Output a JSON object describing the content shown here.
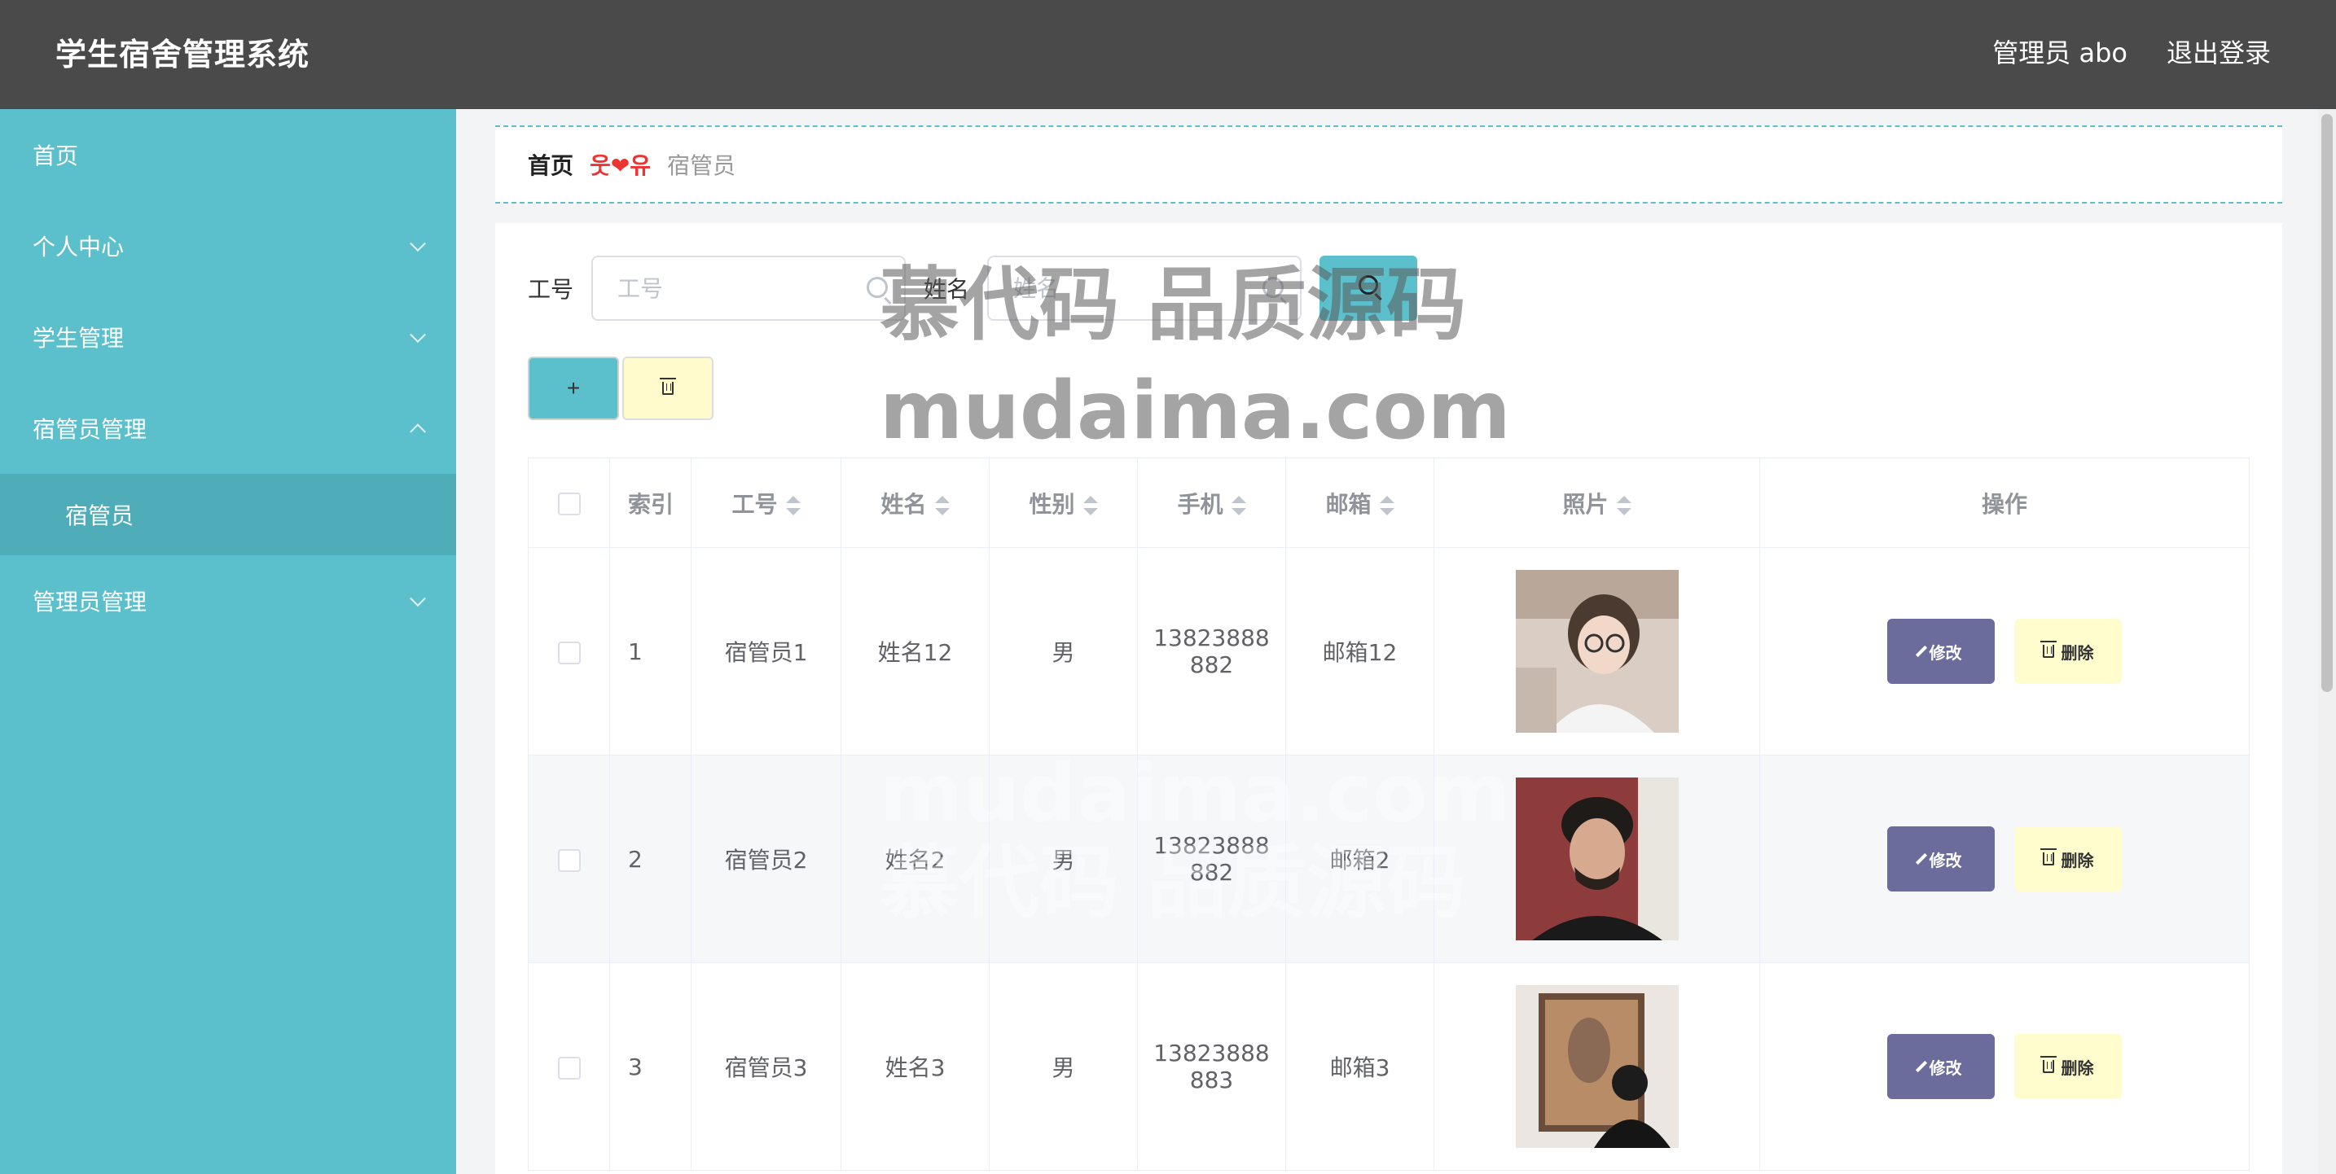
{
  "header": {
    "app_title": "学生宿舍管理系统",
    "admin_label": "管理员 abo",
    "logout_label": "退出登录"
  },
  "sidebar": {
    "items": [
      {
        "label": "首页",
        "expandable": false
      },
      {
        "label": "个人中心",
        "expandable": true
      },
      {
        "label": "学生管理",
        "expandable": true
      },
      {
        "label": "宿管员管理",
        "expandable": true,
        "expanded": true,
        "children": [
          {
            "label": "宿管员"
          }
        ]
      },
      {
        "label": "管理员管理",
        "expandable": true
      }
    ]
  },
  "breadcrumb": {
    "home": "首页",
    "separator": "웃❤유",
    "current": "宿管员"
  },
  "search": {
    "field1_label": "工号",
    "field1_placeholder": "工号",
    "field2_label": "姓名",
    "field2_placeholder": "姓名"
  },
  "actions": {
    "add_label": "+"
  },
  "table": {
    "headers": [
      "索引",
      "工号",
      "姓名",
      "性别",
      "手机",
      "邮箱",
      "照片",
      "操作"
    ],
    "edit_label": "修改",
    "delete_label": "删除",
    "rows": [
      {
        "index": "1",
        "job_no": "宿管员1",
        "name": "姓名12",
        "gender": "男",
        "phone_line1": "13823888",
        "phone_line2": "882",
        "email": "邮箱12",
        "photo": "avatar-girl-glasses"
      },
      {
        "index": "2",
        "job_no": "宿管员2",
        "name": "姓名2",
        "gender": "男",
        "phone_line1": "13823888",
        "phone_line2": "882",
        "email": "邮箱2",
        "photo": "avatar-man-portrait"
      },
      {
        "index": "3",
        "job_no": "宿管员3",
        "name": "姓名3",
        "gender": "男",
        "phone_line1": "13823888",
        "phone_line2": "883",
        "email": "邮箱3",
        "photo": "avatar-man-gallery"
      }
    ]
  },
  "watermark": {
    "line1": "慕代码 品质源码",
    "line2": "mudaima.com"
  },
  "colors": {
    "header_bg": "#4a4a4a",
    "sidebar_bg": "#5bc0cc",
    "edit_button": "#6b6b9c",
    "delete_button": "#fffccd"
  }
}
